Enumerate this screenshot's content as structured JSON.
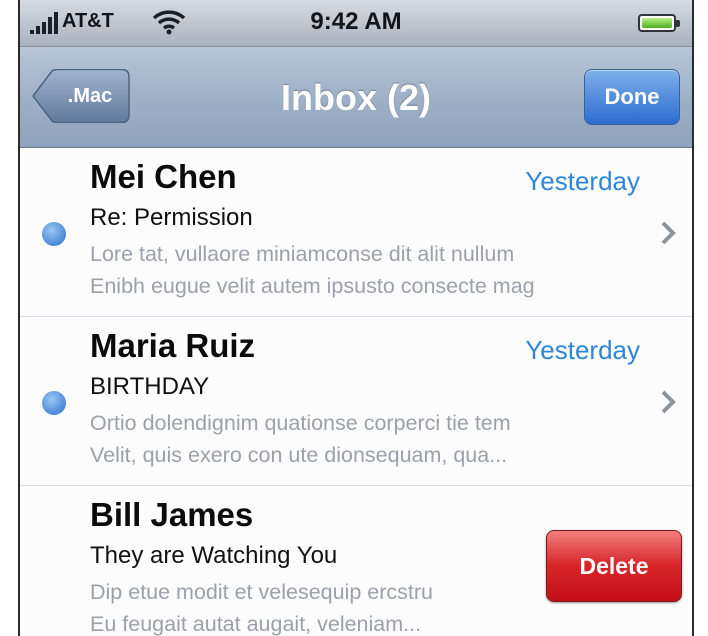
{
  "status_bar": {
    "carrier": "AT&T",
    "time": "9:42 AM"
  },
  "nav": {
    "back_label": ".Mac",
    "title": "Inbox (2)",
    "done_label": "Done"
  },
  "messages": [
    {
      "sender": "Mei Chen",
      "date": "Yesterday",
      "subject": "Re: Permission",
      "preview_line1": "Lore tat, vullaore miniamconse dit alit nullum",
      "preview_line2": "Enibh eugue velit autem ipsusto consecte mag",
      "unread": true
    },
    {
      "sender": "Maria Ruiz",
      "date": "Yesterday",
      "subject": "BIRTHDAY",
      "preview_line1": "Ortio dolendignim quationse corperci tie tem",
      "preview_line2": "Velit, quis exero con ute dionsequam, qua...",
      "unread": true
    },
    {
      "sender": "Bill James",
      "subject": "They are Watching You",
      "preview_line1": "Dip etue modit et velesequip ercstru",
      "preview_line2": "Eu feugait autat augait, veleniam...",
      "unread": false,
      "delete_label": "Delete"
    }
  ],
  "colors": {
    "accent_blue": "#2f86d9",
    "delete_red": "#d8262a",
    "nav_bar": "#9fb1c7"
  }
}
